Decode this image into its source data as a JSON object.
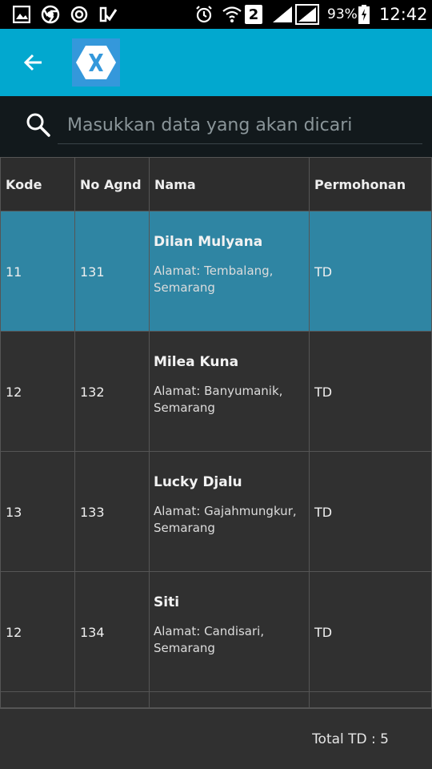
{
  "status_bar": {
    "icons": [
      "gallery-icon",
      "chrome-icon",
      "sync-icon",
      "check-icon",
      "alarm-icon",
      "wifi-icon",
      "sim-2-icon",
      "signal-icon",
      "signal-icon",
      "battery-charging-icon"
    ],
    "sim_label": "2",
    "battery": "93%",
    "time": "12:42"
  },
  "action_bar": {
    "back_icon": "arrow-left-icon",
    "logo_icon": "xamarin-logo-icon",
    "color": "#02a8cf"
  },
  "search": {
    "icon": "search-icon",
    "placeholder": "Masukkan data yang akan dicari",
    "value": ""
  },
  "table": {
    "columns": [
      "Kode",
      "No Agnd",
      "Nama",
      "Permohonan"
    ],
    "rows": [
      {
        "kode": "11",
        "no_agnd": "131",
        "nama": "Dilan Mulyana",
        "alamat": "Alamat: Tembalang, Semarang",
        "permohonan": "TD",
        "selected": true
      },
      {
        "kode": "12",
        "no_agnd": "132",
        "nama": "Milea Kuna",
        "alamat": "Alamat: Banyumanik, Semarang",
        "permohonan": "TD",
        "selected": false
      },
      {
        "kode": "13",
        "no_agnd": "133",
        "nama": "Lucky Djalu",
        "alamat": "Alamat: Gajahmungkur, Semarang",
        "permohonan": "TD",
        "selected": false
      },
      {
        "kode": "12",
        "no_agnd": "134",
        "nama": "Siti",
        "alamat": "Alamat: Candisari, Semarang",
        "permohonan": "TD",
        "selected": false
      }
    ],
    "selected_color": "#2f85a3"
  },
  "footer": {
    "total": "Total TD : 5"
  }
}
